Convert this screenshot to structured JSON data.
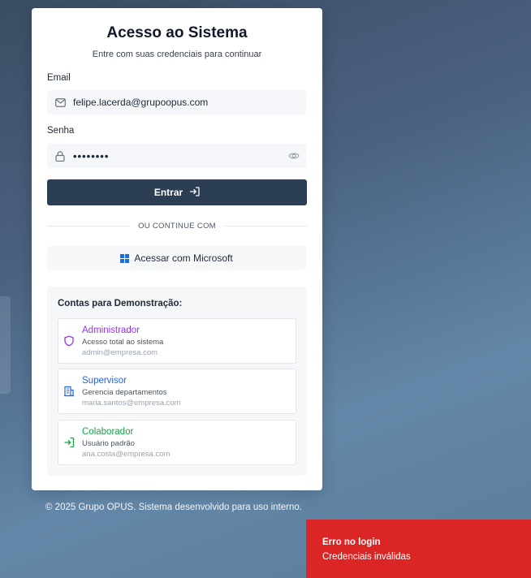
{
  "login": {
    "title": "Acesso ao Sistema",
    "subtitle": "Entre com suas credenciais para continuar",
    "email_label": "Email",
    "email_value": "felipe.lacerda@grupoopus.com",
    "password_label": "Senha",
    "password_value": "••••••••",
    "submit_label": "Entrar",
    "divider_text": "OU CONTINUE COM",
    "microsoft_label": "Acessar com Microsoft"
  },
  "demo": {
    "title": "Contas para Demonstração:",
    "accounts": [
      {
        "name": "Administrador",
        "description": "Acesso total ao sistema",
        "email": "admin@empresa.com",
        "color": "#9333ea",
        "icon": "shield-icon"
      },
      {
        "name": "Supervisor",
        "description": "Gerencia departamentos",
        "email": "maria.santos@empresa.com",
        "color": "#2563eb",
        "icon": "building-icon"
      },
      {
        "name": "Colaborador",
        "description": "Usuário padrão",
        "email": "ana.costa@empresa.com",
        "color": "#16a34a",
        "icon": "login-icon"
      }
    ]
  },
  "footer": {
    "text": "© 2025 Grupo OPUS. Sistema desenvolvido para uso interno."
  },
  "toast": {
    "title": "Erro no login",
    "message": "Credenciais inválidas",
    "color": "#dc2626"
  },
  "colors": {
    "primary_button": "#2c3e54",
    "microsoft_blue": "#1d6fe0"
  }
}
